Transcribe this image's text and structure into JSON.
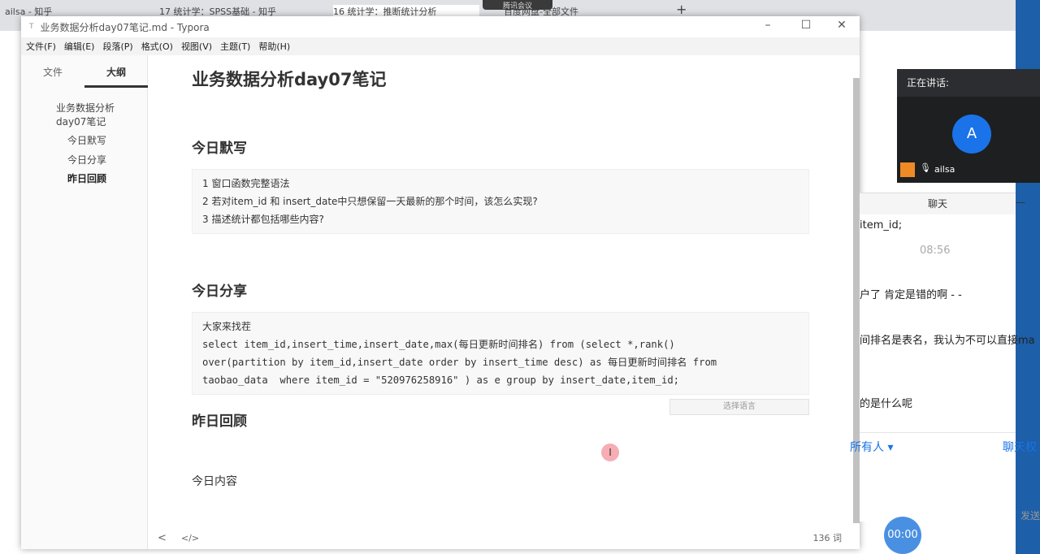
{
  "browser": {
    "tabs": [
      "ailsa - 知乎",
      "17 统计学：SPSS基础 - 知乎",
      "16 统计学：推断统计分析",
      "百度网盘-全部文件"
    ],
    "new_tab": "+",
    "meeting_badge": "腾讯会议"
  },
  "window": {
    "title": "业务数据分析day07笔记.md - Typora",
    "minimize": "–",
    "maximize": "☐",
    "close": "✕"
  },
  "menu": [
    "文件(F)",
    "编辑(E)",
    "段落(P)",
    "格式(O)",
    "视图(V)",
    "主题(T)",
    "帮助(H)"
  ],
  "sidebar": {
    "tabs": [
      "文件",
      "大纲"
    ],
    "active_tab": "大纲",
    "outline": [
      "业务数据分析day07笔记",
      "今日默写",
      "今日分享",
      "昨日回顾"
    ]
  },
  "doc": {
    "title": "业务数据分析day07笔记",
    "h_dictation": "今日默写",
    "dictation_lines": [
      "1 窗口函数完整语法",
      "2 若对item_id 和 insert_date中只想保留一天最新的那个时间，该怎么实现?",
      "3 描述统计都包括哪些内容?"
    ],
    "h_share": "今日分享",
    "share_lines": [
      "大家来找茬",
      "select item_id,insert_time,insert_date,max(每日更新时间排名) from (select *,rank()",
      "over(partition by item_id,insert_date order by insert_time desc) as 每日更新时间排名 from",
      "taobao_data  where item_id = \"520976258916\" ) as e group by insert_date,item_id;"
    ],
    "lang_select": "选择语言",
    "h_review": "昨日回顾",
    "today_content": "今日内容"
  },
  "status": {
    "back": "<",
    "source": "</>",
    "word_count": "136 词"
  },
  "meeting": {
    "speaking_label": "正在讲话:",
    "avatar_letter": "A",
    "speaker": "ailsa"
  },
  "chat": {
    "title": "聊天",
    "minimize": "—",
    "messages": [
      "item_id;",
      "08:56",
      "户了 肯定是错的啊 - -",
      "间排名是表名，我认为不可以直接ma",
      "的是什么呢"
    ],
    "recipient": "所有人 ▾",
    "permission": "聊天权",
    "send": "发送"
  },
  "timer": "00:00"
}
